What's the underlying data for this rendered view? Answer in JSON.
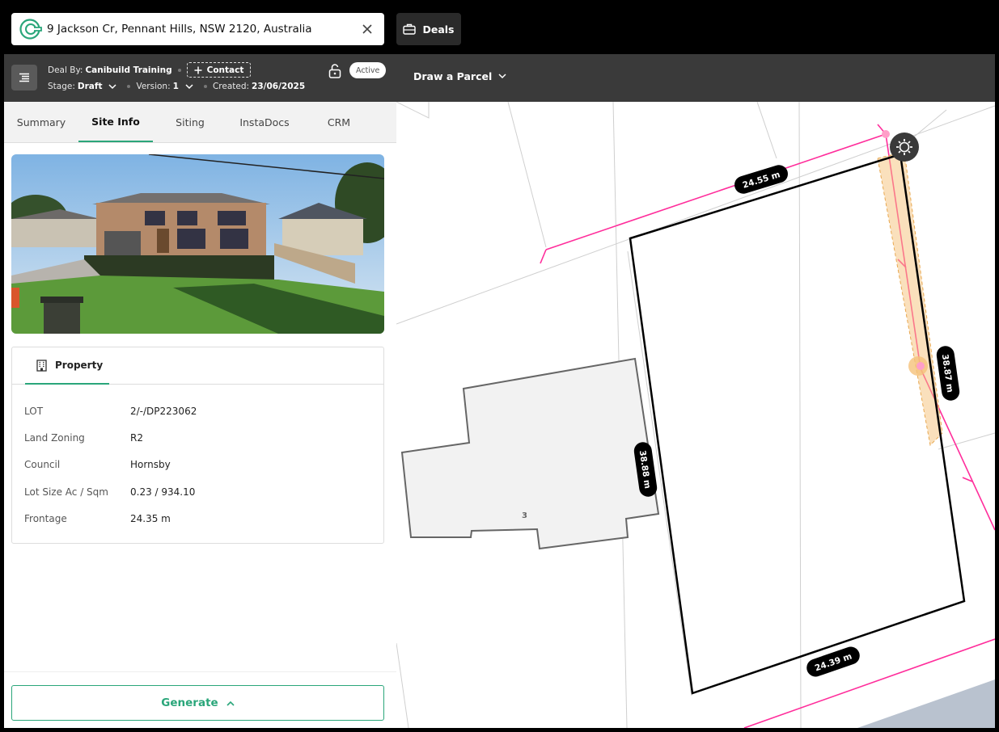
{
  "search": {
    "address": "9 Jackson Cr, Pennant Hills, NSW 2120, Australia"
  },
  "deals_label": "Deals",
  "deal": {
    "by_label": "Deal By:",
    "by_value": "Canibuild Training",
    "contact_label": "Contact",
    "stage_label": "Stage:",
    "stage_value": "Draft",
    "version_label": "Version:",
    "version_value": "1",
    "created_label": "Created:",
    "created_value": "23/06/2025",
    "status": "Active"
  },
  "tabs": [
    "Summary",
    "Site Info",
    "Siting",
    "InstaDocs",
    "CRM"
  ],
  "active_tab": "Site Info",
  "property": {
    "tab_label": "Property",
    "rows": [
      {
        "label": "LOT",
        "value": "2/-/DP223062"
      },
      {
        "label": "Land Zoning",
        "value": "R2"
      },
      {
        "label": "Council",
        "value": "Hornsby"
      },
      {
        "label": "Lot Size Ac / Sqm",
        "value": "0.23 / 934.10"
      },
      {
        "label": "Frontage",
        "value": "24.35 m"
      }
    ]
  },
  "generate_label": "Generate",
  "map": {
    "toolbar_label": "Draw a Parcel",
    "dimensions": {
      "top": "24.55 m",
      "right": "38.87 m",
      "left": "38.88 m",
      "bottom": "24.39 m"
    },
    "neighbour_lot": "3",
    "colors": {
      "boundary": "#000000",
      "easement": "#ff2d9b",
      "setback": "#f5c27a"
    }
  },
  "colors": {
    "accent": "#2aa67a",
    "header_bg": "#3a3a3a"
  },
  "icons": {
    "logo": "canibuild-logo",
    "clear": "close-icon",
    "deals": "briefcase-icon",
    "menu": "menu-icon",
    "lock": "unlock-icon",
    "building": "building-icon",
    "settings": "gear-icon"
  }
}
